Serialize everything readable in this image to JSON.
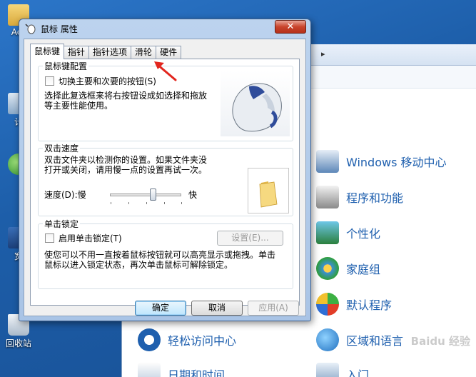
{
  "desktop": {
    "icons": [
      {
        "label": "Adr",
        "icon": "user-folder-icon"
      },
      {
        "label": "计",
        "icon": "computer-icon"
      },
      {
        "label": "宽",
        "icon": "broadband-icon"
      },
      {
        "label": "回收站",
        "icon": "recycle-bin-icon"
      }
    ]
  },
  "control_panel": {
    "nav_arrow": "▸",
    "items": [
      {
        "label": "Windows 移动中心",
        "icon": "mobility-center-icon"
      },
      {
        "label": "程序和功能",
        "icon": "programs-features-icon"
      },
      {
        "label": "个性化",
        "icon": "personalization-icon"
      },
      {
        "label": "家庭组",
        "icon": "homegroup-icon"
      },
      {
        "label": "默认程序",
        "icon": "default-programs-icon"
      },
      {
        "label": "轻松访问中心",
        "icon": "ease-of-access-icon"
      },
      {
        "label": "区域和语言",
        "icon": "region-language-icon"
      },
      {
        "label": "日期和时间",
        "icon": "date-time-icon"
      },
      {
        "label": "入门",
        "icon": "getting-started-icon"
      }
    ]
  },
  "dialog": {
    "title": "鼠标 属性",
    "close_label": "✕",
    "tabs": [
      "鼠标键",
      "指针",
      "指针选项",
      "滑轮",
      "硬件"
    ],
    "active_tab": "鼠标键",
    "button_config": {
      "title": "鼠标键配置",
      "checkbox_label": "切换主要和次要的按钮(S)",
      "checked": false,
      "desc_1": "选择此复选框来将右按钮设成如选择和拖放",
      "desc_2": "等主要性能使用。"
    },
    "double_click": {
      "title": "双击速度",
      "desc_1": "双击文件夹以检测你的设置。如果文件夹没",
      "desc_2": "打开或关闭，请用慢一点的设置再试一次。",
      "speed_label": "速度(D):慢",
      "fast_label": "快",
      "speed_value": 0.6
    },
    "click_lock": {
      "title": "单击锁定",
      "checkbox_label": "启用单击锁定(T)",
      "checked": false,
      "settings_label": "设置(E)...",
      "desc_1": "使您可以不用一直按着鼠标按钮就可以高亮显示或拖拽。单击",
      "desc_2": "鼠标以进入锁定状态，再次单击鼠标可解除锁定。"
    },
    "buttons": {
      "ok": "确定",
      "cancel": "取消",
      "apply": "应用(A)"
    }
  },
  "watermark": "Baidu 经验"
}
